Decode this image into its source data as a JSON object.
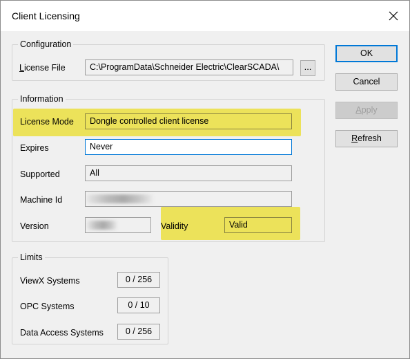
{
  "window": {
    "title": "Client Licensing"
  },
  "configuration": {
    "legend": "Configuration",
    "license_file_label": "License File",
    "license_file_value": "C:\\ProgramData\\Schneider Electric\\ClearSCADA\\",
    "browse_label": "..."
  },
  "information": {
    "legend": "Information",
    "license_mode_label": "License Mode",
    "license_mode_value": "Dongle controlled client license",
    "expires_label": "Expires",
    "expires_value": "Never",
    "supported_label": "Supported",
    "supported_value": "All",
    "machine_id_label": "Machine Id",
    "version_label": "Version",
    "validity_label": "Validity",
    "validity_value": "Valid"
  },
  "limits": {
    "legend": "Limits",
    "viewx_label": "ViewX Systems",
    "viewx_value": "0 / 256",
    "opc_label": "OPC Systems",
    "opc_value": "0 / 10",
    "data_access_label": "Data Access Systems",
    "data_access_value": "0 / 256"
  },
  "buttons": {
    "ok": "OK",
    "cancel": "Cancel",
    "apply": "Apply",
    "refresh": "Refresh"
  },
  "colors": {
    "highlight": "#ece25a",
    "accent": "#0078d7"
  }
}
